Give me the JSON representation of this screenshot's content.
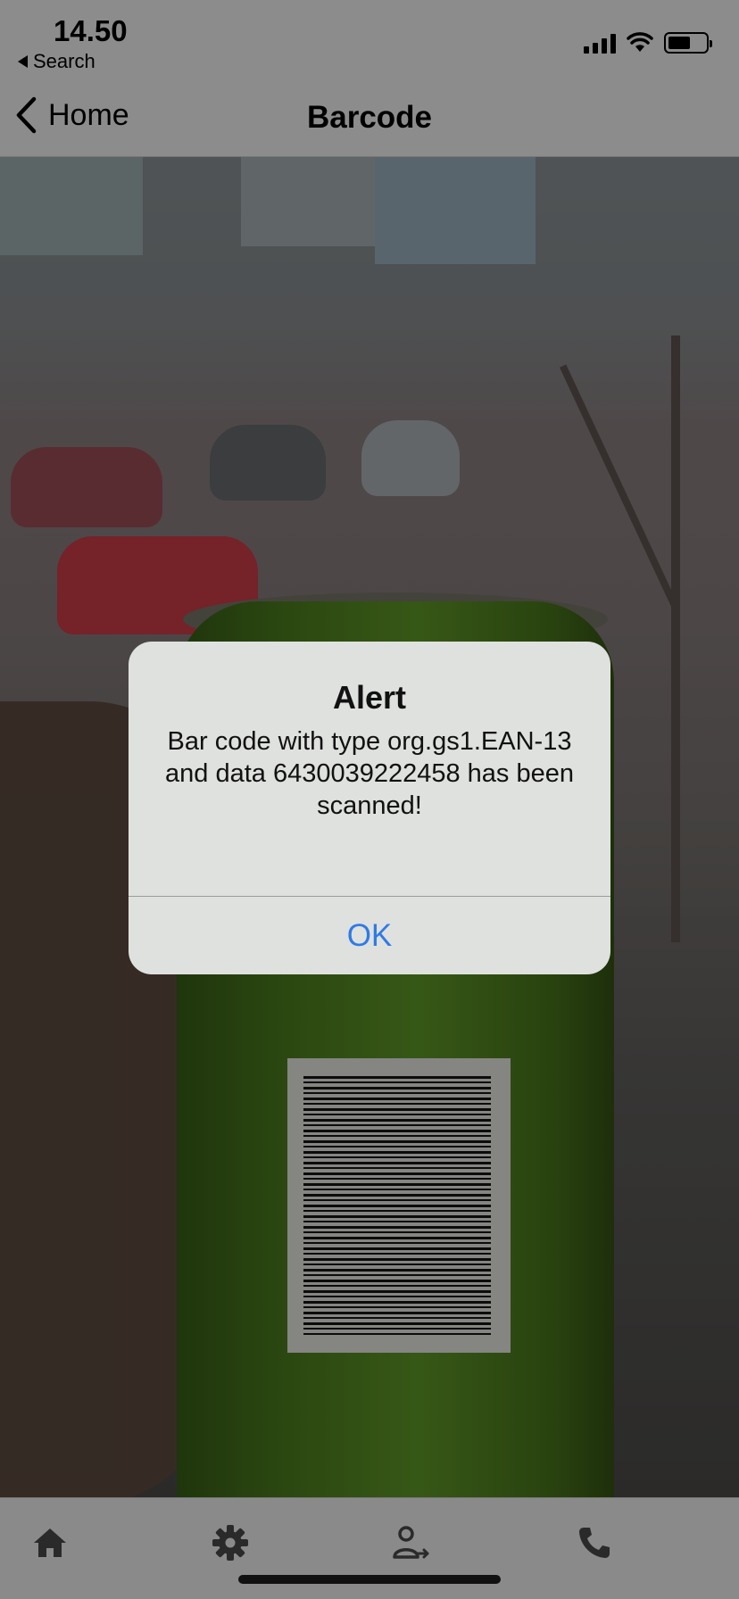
{
  "status_bar": {
    "time": "14.50",
    "back_app_label": "Search",
    "signal_icon": "cellular-signal-icon",
    "wifi_icon": "wifi-icon",
    "battery_icon": "battery-icon",
    "battery_level": 0.6
  },
  "nav": {
    "back_label": "Home",
    "title": "Barcode"
  },
  "alert": {
    "title": "Alert",
    "message": "Bar code with type org.gs1.EAN-13 and data 6430039222458 has been scanned!",
    "ok_label": "OK"
  },
  "tab_bar": {
    "items": [
      {
        "icon": "home-icon"
      },
      {
        "icon": "gear-icon"
      },
      {
        "icon": "user-transfer-icon"
      },
      {
        "icon": "phone-icon"
      }
    ]
  },
  "colors": {
    "alert_button": "#2f7be6",
    "bars_background": "#8c8c8c"
  }
}
